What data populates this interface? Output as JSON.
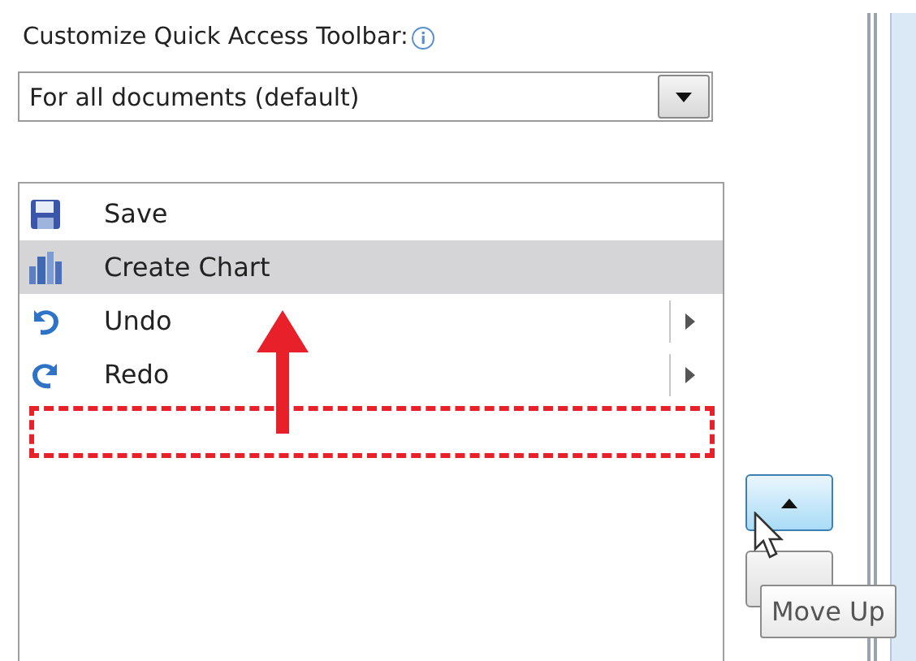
{
  "toolbar_label": {
    "text": "Customize Quick Access Toolbar:"
  },
  "scope_dropdown": {
    "value": "For all documents (default)"
  },
  "commands": [
    {
      "label": "Save",
      "selected": false,
      "submenu": false
    },
    {
      "label": "Create Chart",
      "selected": true,
      "submenu": false
    },
    {
      "label": "Undo",
      "selected": false,
      "submenu": true
    },
    {
      "label": "Redo",
      "selected": false,
      "submenu": true
    }
  ],
  "order_buttons": [
    {
      "kind": "up",
      "hovered": true
    },
    {
      "kind": "down",
      "hovered": false
    }
  ],
  "tooltip": {
    "text": "Move Up"
  }
}
